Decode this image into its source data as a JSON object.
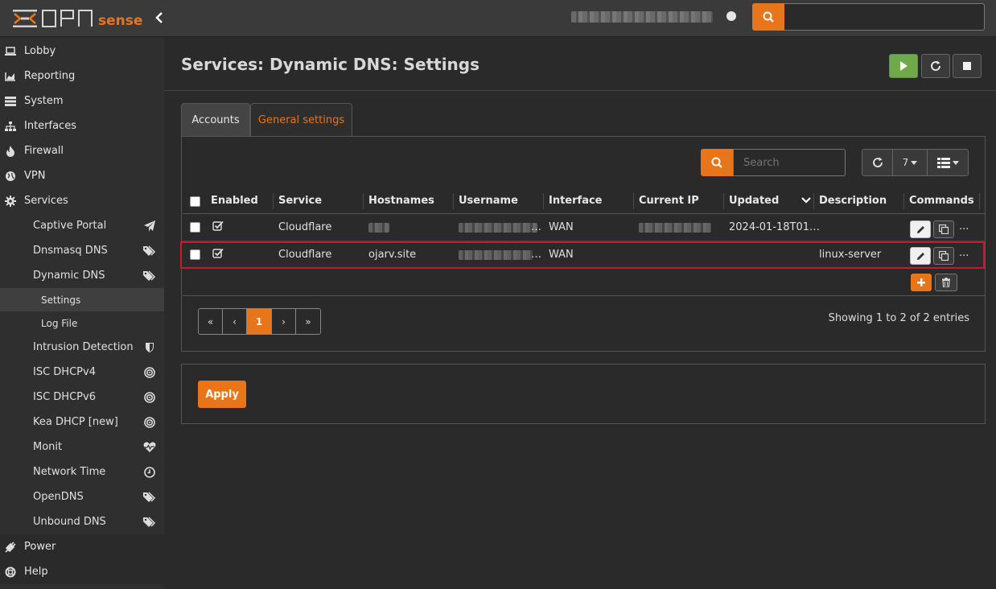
{
  "top": {
    "search_placeholder": ""
  },
  "sidebar": {
    "items": [
      {
        "label": "Lobby",
        "icon": "laptop-icon"
      },
      {
        "label": "Reporting",
        "icon": "area-chart-icon"
      },
      {
        "label": "System",
        "icon": "server-icon"
      },
      {
        "label": "Interfaces",
        "icon": "sitemap-icon"
      },
      {
        "label": "Firewall",
        "icon": "fire-icon"
      },
      {
        "label": "VPN",
        "icon": "globe-icon"
      },
      {
        "label": "Services",
        "icon": "gear-icon"
      }
    ],
    "services": [
      {
        "label": "Captive Portal",
        "icon": "paper-plane-icon"
      },
      {
        "label": "Dnsmasq DNS",
        "icon": "tags-icon"
      },
      {
        "label": "Dynamic DNS",
        "icon": "tags-icon"
      }
    ],
    "ddns_sub": [
      {
        "label": "Settings"
      },
      {
        "label": "Log File"
      }
    ],
    "services_more": [
      {
        "label": "Intrusion Detection",
        "icon": "shield-icon"
      },
      {
        "label": "ISC DHCPv4",
        "icon": "bullseye-icon"
      },
      {
        "label": "ISC DHCPv6",
        "icon": "bullseye-icon"
      },
      {
        "label": "Kea DHCP [new]",
        "icon": "bullseye-icon"
      },
      {
        "label": "Monit",
        "icon": "heartbeat-icon"
      },
      {
        "label": "Network Time",
        "icon": "clock-icon"
      },
      {
        "label": "OpenDNS",
        "icon": "tags-icon"
      },
      {
        "label": "Unbound DNS",
        "icon": "tags-icon"
      }
    ],
    "bottom": [
      {
        "label": "Power",
        "icon": "plug-icon"
      },
      {
        "label": "Help",
        "icon": "life-ring-icon"
      }
    ]
  },
  "page": {
    "title": "Services: Dynamic DNS: Settings"
  },
  "tabs": [
    {
      "label": "Accounts"
    },
    {
      "label": "General settings"
    }
  ],
  "grid": {
    "search_placeholder": "Search",
    "page_size": "7",
    "columns": [
      "Enabled",
      "Service",
      "Hostnames",
      "Username",
      "Interface",
      "Current IP",
      "Updated",
      "Description",
      "Commands"
    ],
    "rows": [
      {
        "service": "Cloudflare",
        "hostnames": "",
        "username": "…",
        "interface": "WAN",
        "current_ip": "",
        "updated": "2024-01-18T01…",
        "description": ""
      },
      {
        "service": "Cloudflare",
        "hostnames": "ojarv.site",
        "username": "…",
        "interface": "WAN",
        "current_ip": "",
        "updated": "",
        "description": "linux-server"
      }
    ],
    "pagination": {
      "first": "«",
      "prev": "‹",
      "current": "1",
      "next": "›",
      "last": "»"
    },
    "showing": "Showing 1 to 2 of 2 entries"
  },
  "apply_label": "Apply",
  "colors": {
    "accent": "#e8751a",
    "start": "#6fa94a",
    "highlight": "#d0152a"
  }
}
